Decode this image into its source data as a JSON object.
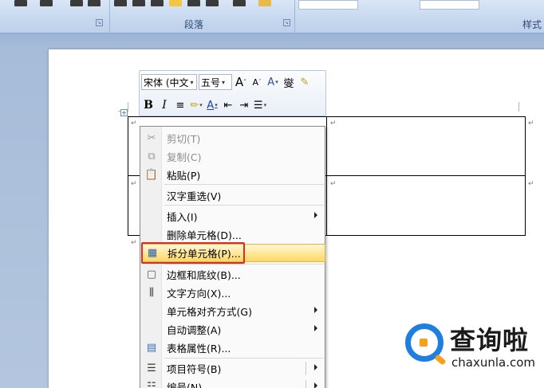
{
  "ribbon": {
    "paragraph_group_label": "段落",
    "styles_group_label": "样式"
  },
  "mini_toolbar": {
    "font_name": "宋体 (中文",
    "font_size": "五号",
    "grow_font": "A",
    "shrink_font": "A",
    "bold": "B",
    "italic": "I",
    "font_color": "A"
  },
  "menu": {
    "items": [
      {
        "label": "剪切(T)",
        "icon": "scissors-icon",
        "disabled": true
      },
      {
        "label": "复制(C)",
        "icon": "copy-icon",
        "disabled": true
      },
      {
        "label": "粘贴(P)",
        "icon": "paste-icon",
        "disabled": false
      },
      {
        "label": "汉字重选(V)",
        "icon": "",
        "disabled": false
      },
      {
        "label": "插入(I)",
        "icon": "",
        "disabled": false,
        "submenu": true
      },
      {
        "label": "删除单元格(D)...",
        "icon": "",
        "disabled": false
      },
      {
        "label": "拆分单元格(P)...",
        "icon": "split-cells-icon",
        "disabled": false,
        "highlighted": true
      },
      {
        "label": "边框和底纹(B)...",
        "icon": "borders-icon",
        "disabled": false
      },
      {
        "label": "文字方向(X)...",
        "icon": "text-direction-icon",
        "disabled": false
      },
      {
        "label": "单元格对齐方式(G)",
        "icon": "",
        "disabled": false,
        "submenu": true
      },
      {
        "label": "自动调整(A)",
        "icon": "",
        "disabled": false,
        "submenu": true
      },
      {
        "label": "表格属性(R)...",
        "icon": "table-properties-icon",
        "disabled": false
      },
      {
        "label": "项目符号(B)",
        "icon": "bullets-icon",
        "disabled": false,
        "submenu": true,
        "split": true
      },
      {
        "label": "编号(N)",
        "icon": "numbering-icon",
        "disabled": false,
        "submenu": true,
        "split": true
      }
    ]
  },
  "watermark": {
    "brand": "查询啦",
    "domain": "chaxunla.com"
  },
  "colors": {
    "highlight_border": "#e02b24",
    "menu_highlight": "#ffe79c",
    "brand_blue": "#1e7fe0",
    "brand_orange": "#f6a11c"
  }
}
